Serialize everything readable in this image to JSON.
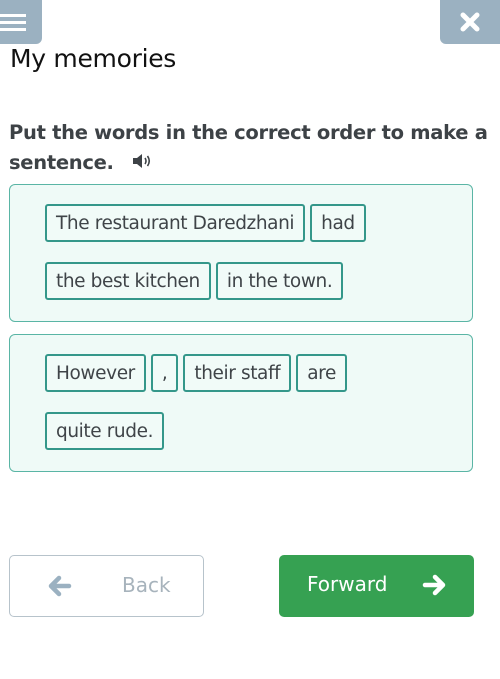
{
  "header": {
    "menu_icon": "hamburger-icon",
    "close_icon": "close-icon",
    "title": "My memories"
  },
  "exercise": {
    "instruction": "Put the words in the correct order to make a sentence.",
    "audio_icon": "speaker-icon",
    "sentences": [
      {
        "chips": [
          "The restaurant Daredzhani",
          "had",
          "the best kitchen",
          "in the town."
        ]
      },
      {
        "chips": [
          "However",
          ",",
          "their staff",
          "are",
          "quite rude."
        ]
      }
    ]
  },
  "nav": {
    "back_label": "Back",
    "back_icon": "arrow-left-icon",
    "forward_label": "Forward",
    "forward_icon": "arrow-right-icon"
  },
  "colors": {
    "accent_teal": "#34978a",
    "box_bg": "#effaf7",
    "forward_green": "#36a152",
    "header_button": "#9bb1c1"
  }
}
